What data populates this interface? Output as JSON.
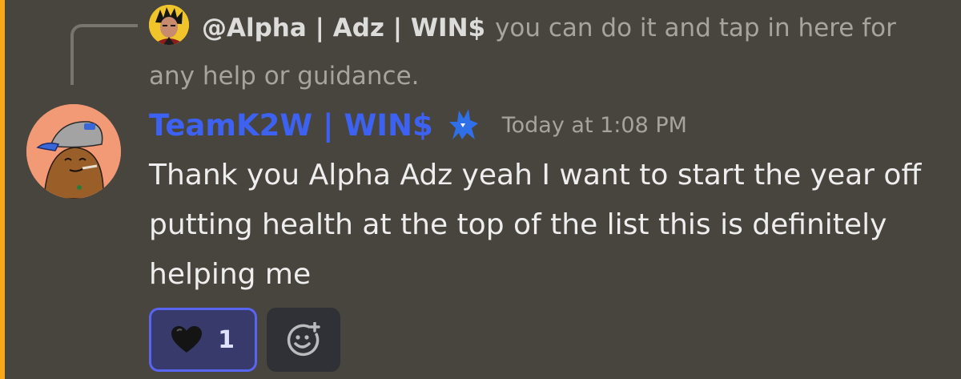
{
  "colors": {
    "mention_highlight": "#faa81a",
    "username_color": "#3d62f2",
    "reaction_border": "#5865f2",
    "background": "#48443e"
  },
  "reply": {
    "author": "@Alpha | Adz | WIN$",
    "text": "you can do it and tap in here for any help or guidance.",
    "avatar_icon": "user-avatar"
  },
  "message": {
    "author": "TeamK2W | WIN$",
    "role_icon": "wolf-icon",
    "timestamp": "Today at 1:08 PM",
    "content": "Thank you Alpha Adz yeah I want to start the year off putting health at the top of the list this is definitely helping me",
    "avatar_icon": "cartoon-avatar"
  },
  "reactions": [
    {
      "emoji": "🖤",
      "icon": "black-heart-icon",
      "count": "1",
      "selected": true
    }
  ],
  "add_reaction_icon": "add-reaction-icon"
}
